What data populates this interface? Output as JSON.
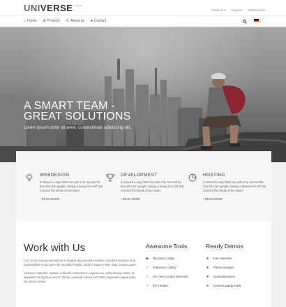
{
  "logo": {
    "part1": "UNI",
    "part2": "VERSE",
    "tag": "THEME"
  },
  "topbar": {
    "links": [
      "About us",
      "Support",
      "Testimonials"
    ]
  },
  "nav": {
    "items": [
      {
        "label": "Home",
        "icon": "home-icon"
      },
      {
        "label": "Projects",
        "icon": "gears-icon"
      },
      {
        "label": "About us",
        "icon": "refresh-icon"
      },
      {
        "label": "Contact",
        "icon": "user-icon"
      }
    ],
    "language_flag": "de"
  },
  "hero": {
    "title_line1": "A SMART TEAM -",
    "title_line2": "GREAT SOLUTIONS",
    "subtitle": "Lorem ipsum dolor sit amet, consectetuer adipiscing elit."
  },
  "services": [
    {
      "title": "WEBDESIGN",
      "icon": "lightbulb-icon",
      "text": "It showed a lady fitted out with a fur hat and fur boa who sat upright, raising a heavy fur muff that covered the whole of her lower.",
      "more": "READ MORE"
    },
    {
      "title": "DEVELOPMENT",
      "icon": "trophy-icon",
      "text": "It showed a lady fitted out with a fur hat and fur boa who sat upright, raising a heavy fur muff that covered the whole of her lower.",
      "more": "READ MORE"
    },
    {
      "title": "HOSTING",
      "icon": "pie-chart-icon",
      "text": "It showed a lady fitted out with a fur hat and fur boa who sat upright, raising a heavy fur muff that covered the whole of her lower.",
      "more": "READ MORE"
    }
  ],
  "work": {
    "title": "Work with Us",
    "p1": "Cum sociis natoque penatibus et magnis dis parturient montes, nascetur ridiculus mus. Suspendisse et dui quis nisl convallis fringilla. Morbi a sapien nulla, vitae congue quam.",
    "p2": "Vivamus imperdiet, massa eu blandit consectetur, magna nunc pellentesque tellus, at dignissim dui ligula ac lectus. Donec euismod viverra est. Etiam imperdiet magna justo, vel rutrum metus."
  },
  "tools": {
    "title": "Awesome Tools",
    "items": [
      {
        "label": "Revolution Slider",
        "icon": "play-icon"
      },
      {
        "label": "Fullscreen Gallery",
        "icon": "check-icon"
      },
      {
        "label": "20+ new Content Elements",
        "icon": "check-icon"
      },
      {
        "label": "20+ Header",
        "icon": "check-icon"
      }
    ]
  },
  "demos": {
    "title": "Ready Demos",
    "items": [
      {
        "label": "Font Awesome",
        "icon": "star-icon"
      },
      {
        "label": "Theme Designer",
        "icon": "star-icon"
      },
      {
        "label": "CustomElements",
        "icon": "star-icon"
      },
      {
        "label": "CustomCatalog ready",
        "icon": "star-icon"
      }
    ]
  }
}
